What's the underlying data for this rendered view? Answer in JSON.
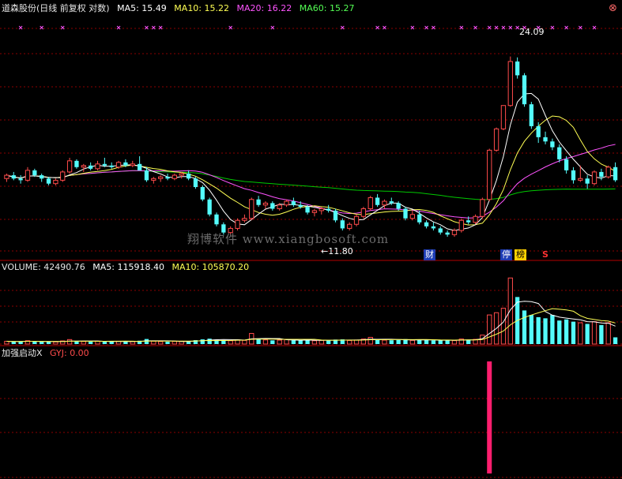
{
  "header": {
    "title": "道森股份(日线 前复权 对数)",
    "ma5": "MA5: 15.49",
    "ma10": "MA10: 15.22",
    "ma20": "MA20: 16.22",
    "ma60": "MA60: 15.27",
    "close_button": "⊗"
  },
  "colors": {
    "up": "#ff4b4b",
    "down": "#54fcfc",
    "ma5": "#ffffff",
    "ma10": "#ffff54",
    "ma20": "#ff54ff",
    "ma60": "#00c800",
    "grid": "#8b0000",
    "signal": "#ff1e6e"
  },
  "annotations": {
    "high_label": "24.09",
    "low_label": "←11.80",
    "badge_cai": "财",
    "badge_ting": "停",
    "badge_bang": "榜",
    "badge_s": "S"
  },
  "watermark": "翔博软件 www.xiangbosoft.com",
  "volume_header": {
    "volume": "VOLUME: 42490.76",
    "ma5": "MA5: 115918.40",
    "ma10": "MA10: 105870.20"
  },
  "indicator_header": {
    "name": "加强启动X",
    "gyj": "GYJ: 0.00"
  },
  "chart_data": {
    "type": "candlestick",
    "scale": "log",
    "price_range": [
      11.5,
      26
    ],
    "candles": [
      [
        14.6,
        14.9,
        14.4,
        14.8
      ],
      [
        14.8,
        15.0,
        14.5,
        14.6
      ],
      [
        14.6,
        14.8,
        14.3,
        14.5
      ],
      [
        14.5,
        15.3,
        14.4,
        15.1
      ],
      [
        15.1,
        15.2,
        14.7,
        14.8
      ],
      [
        14.8,
        14.9,
        14.4,
        14.6
      ],
      [
        14.6,
        14.7,
        14.2,
        14.3
      ],
      [
        14.3,
        14.6,
        14.2,
        14.5
      ],
      [
        14.5,
        15.1,
        14.4,
        15.0
      ],
      [
        15.0,
        15.9,
        14.9,
        15.7
      ],
      [
        15.7,
        15.8,
        15.2,
        15.3
      ],
      [
        15.3,
        15.5,
        15.0,
        15.4
      ],
      [
        15.4,
        15.6,
        15.1,
        15.2
      ],
      [
        15.2,
        15.7,
        15.1,
        15.5
      ],
      [
        15.5,
        15.9,
        15.3,
        15.4
      ],
      [
        15.4,
        15.6,
        15.2,
        15.3
      ],
      [
        15.3,
        15.7,
        15.2,
        15.6
      ],
      [
        15.6,
        15.8,
        15.3,
        15.4
      ],
      [
        15.4,
        15.7,
        15.3,
        15.5
      ],
      [
        15.5,
        16.0,
        15.3,
        15.1
      ],
      [
        15.1,
        15.3,
        14.4,
        14.5
      ],
      [
        14.5,
        14.7,
        14.3,
        14.6
      ],
      [
        14.6,
        14.8,
        14.4,
        14.7
      ],
      [
        14.7,
        14.9,
        14.5,
        14.6
      ],
      [
        14.6,
        14.9,
        14.5,
        14.8
      ],
      [
        14.8,
        15.0,
        14.6,
        14.9
      ],
      [
        14.9,
        15.1,
        14.5,
        14.6
      ],
      [
        14.6,
        14.7,
        14.0,
        14.1
      ],
      [
        14.1,
        14.2,
        13.3,
        13.4
      ],
      [
        13.4,
        13.5,
        12.5,
        12.6
      ],
      [
        12.6,
        12.7,
        12.0,
        12.1
      ],
      [
        12.1,
        12.2,
        11.6,
        11.7
      ],
      [
        11.7,
        12.0,
        11.6,
        11.9
      ],
      [
        11.9,
        12.4,
        11.8,
        12.3
      ],
      [
        12.3,
        12.6,
        12.2,
        12.4
      ],
      [
        12.4,
        13.5,
        12.3,
        13.4
      ],
      [
        13.4,
        13.6,
        13.0,
        13.1
      ],
      [
        13.1,
        13.3,
        12.9,
        13.2
      ],
      [
        13.2,
        13.3,
        12.8,
        12.9
      ],
      [
        12.9,
        13.2,
        12.8,
        13.1
      ],
      [
        13.1,
        13.4,
        13.0,
        13.3
      ],
      [
        13.3,
        13.5,
        13.0,
        13.1
      ],
      [
        13.1,
        13.3,
        12.9,
        13.0
      ],
      [
        13.0,
        13.1,
        12.6,
        12.7
      ],
      [
        12.7,
        12.9,
        12.5,
        12.8
      ],
      [
        12.8,
        13.0,
        12.6,
        12.9
      ],
      [
        12.9,
        13.1,
        12.7,
        12.8
      ],
      [
        12.8,
        12.9,
        12.2,
        12.3
      ],
      [
        12.3,
        12.4,
        11.8,
        11.9
      ],
      [
        11.9,
        12.2,
        11.8,
        12.1
      ],
      [
        12.1,
        12.6,
        12.0,
        12.5
      ],
      [
        12.5,
        13.0,
        12.4,
        12.9
      ],
      [
        12.9,
        13.6,
        12.8,
        13.5
      ],
      [
        13.5,
        13.7,
        13.0,
        13.1
      ],
      [
        13.1,
        13.4,
        12.9,
        13.3
      ],
      [
        13.3,
        13.5,
        13.1,
        13.2
      ],
      [
        13.2,
        13.3,
        12.8,
        12.9
      ],
      [
        12.9,
        13.0,
        12.3,
        12.4
      ],
      [
        12.4,
        12.8,
        12.3,
        12.6
      ],
      [
        12.6,
        12.8,
        12.1,
        12.2
      ],
      [
        12.2,
        12.3,
        11.9,
        12.0
      ],
      [
        12.0,
        12.2,
        11.8,
        11.9
      ],
      [
        11.9,
        12.0,
        11.6,
        11.7
      ],
      [
        11.7,
        11.8,
        11.5,
        11.6
      ],
      [
        11.6,
        11.9,
        11.5,
        11.8
      ],
      [
        11.8,
        12.4,
        11.7,
        12.3
      ],
      [
        12.3,
        12.5,
        12.1,
        12.2
      ],
      [
        12.2,
        12.6,
        12.1,
        12.5
      ],
      [
        12.5,
        13.5,
        12.4,
        13.4
      ],
      [
        13.4,
        16.5,
        13.3,
        16.4
      ],
      [
        16.4,
        18.0,
        16.3,
        17.9
      ],
      [
        17.9,
        19.7,
        17.8,
        19.7
      ],
      [
        19.7,
        24.09,
        19.6,
        23.6
      ],
      [
        23.6,
        24.0,
        22.0,
        22.3
      ],
      [
        22.3,
        22.5,
        19.6,
        19.8
      ],
      [
        19.8,
        20.0,
        17.9,
        18.1
      ],
      [
        18.1,
        18.4,
        16.9,
        17.3
      ],
      [
        17.3,
        17.7,
        16.8,
        17.0
      ],
      [
        17.0,
        17.2,
        16.4,
        16.6
      ],
      [
        16.6,
        16.8,
        15.6,
        15.8
      ],
      [
        15.8,
        16.0,
        14.9,
        15.1
      ],
      [
        15.1,
        15.3,
        14.3,
        14.5
      ],
      [
        14.5,
        15.4,
        14.4,
        14.6
      ],
      [
        14.6,
        14.8,
        14.0,
        14.3
      ],
      [
        14.3,
        15.1,
        14.2,
        15.0
      ],
      [
        15.0,
        15.2,
        14.5,
        14.7
      ],
      [
        14.7,
        15.4,
        14.6,
        15.3
      ],
      [
        15.3,
        15.6,
        14.4,
        14.5
      ]
    ],
    "volume_range": [
      0,
      620000
    ],
    "volume": [
      25000,
      22000,
      21000,
      30000,
      24000,
      20000,
      22000,
      19000,
      28000,
      40000,
      26000,
      23000,
      22000,
      26000,
      24000,
      21000,
      25000,
      23000,
      22000,
      30000,
      45000,
      26000,
      22000,
      21000,
      24000,
      23000,
      28000,
      35000,
      42000,
      48000,
      40000,
      36000,
      30000,
      38000,
      33000,
      95000,
      48000,
      37000,
      33000,
      35000,
      40000,
      34000,
      32000,
      38000,
      30000,
      33000,
      31000,
      40000,
      42000,
      32000,
      36000,
      45000,
      60000,
      40000,
      35000,
      34000,
      37000,
      44000,
      33000,
      37000,
      35000,
      33000,
      36000,
      32000,
      31000,
      45000,
      40000,
      42000,
      80000,
      260000,
      280000,
      320000,
      590000,
      420000,
      300000,
      260000,
      240000,
      230000,
      260000,
      210000,
      220000,
      200000,
      190000,
      180000,
      200000,
      170000,
      190000,
      60000
    ],
    "signal": {
      "index": 69,
      "value": 1
    }
  }
}
